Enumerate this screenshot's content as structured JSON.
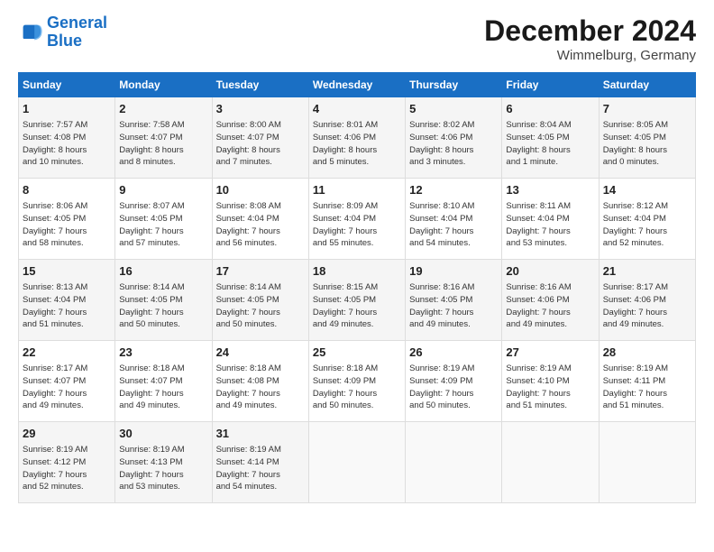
{
  "logo": {
    "line1": "General",
    "line2": "Blue"
  },
  "title": "December 2024",
  "location": "Wimmelburg, Germany",
  "days_of_week": [
    "Sunday",
    "Monday",
    "Tuesday",
    "Wednesday",
    "Thursday",
    "Friday",
    "Saturday"
  ],
  "weeks": [
    [
      {
        "day": "1",
        "sunrise": "7:57 AM",
        "sunset": "4:08 PM",
        "daylight": "8 hours and 10 minutes."
      },
      {
        "day": "2",
        "sunrise": "7:58 AM",
        "sunset": "4:07 PM",
        "daylight": "8 hours and 8 minutes."
      },
      {
        "day": "3",
        "sunrise": "8:00 AM",
        "sunset": "4:07 PM",
        "daylight": "8 hours and 7 minutes."
      },
      {
        "day": "4",
        "sunrise": "8:01 AM",
        "sunset": "4:06 PM",
        "daylight": "8 hours and 5 minutes."
      },
      {
        "day": "5",
        "sunrise": "8:02 AM",
        "sunset": "4:06 PM",
        "daylight": "8 hours and 3 minutes."
      },
      {
        "day": "6",
        "sunrise": "8:04 AM",
        "sunset": "4:05 PM",
        "daylight": "8 hours and 1 minute."
      },
      {
        "day": "7",
        "sunrise": "8:05 AM",
        "sunset": "4:05 PM",
        "daylight": "8 hours and 0 minutes."
      }
    ],
    [
      {
        "day": "8",
        "sunrise": "8:06 AM",
        "sunset": "4:05 PM",
        "daylight": "7 hours and 58 minutes."
      },
      {
        "day": "9",
        "sunrise": "8:07 AM",
        "sunset": "4:05 PM",
        "daylight": "7 hours and 57 minutes."
      },
      {
        "day": "10",
        "sunrise": "8:08 AM",
        "sunset": "4:04 PM",
        "daylight": "7 hours and 56 minutes."
      },
      {
        "day": "11",
        "sunrise": "8:09 AM",
        "sunset": "4:04 PM",
        "daylight": "7 hours and 55 minutes."
      },
      {
        "day": "12",
        "sunrise": "8:10 AM",
        "sunset": "4:04 PM",
        "daylight": "7 hours and 54 minutes."
      },
      {
        "day": "13",
        "sunrise": "8:11 AM",
        "sunset": "4:04 PM",
        "daylight": "7 hours and 53 minutes."
      },
      {
        "day": "14",
        "sunrise": "8:12 AM",
        "sunset": "4:04 PM",
        "daylight": "7 hours and 52 minutes."
      }
    ],
    [
      {
        "day": "15",
        "sunrise": "8:13 AM",
        "sunset": "4:04 PM",
        "daylight": "7 hours and 51 minutes."
      },
      {
        "day": "16",
        "sunrise": "8:14 AM",
        "sunset": "4:05 PM",
        "daylight": "7 hours and 50 minutes."
      },
      {
        "day": "17",
        "sunrise": "8:14 AM",
        "sunset": "4:05 PM",
        "daylight": "7 hours and 50 minutes."
      },
      {
        "day": "18",
        "sunrise": "8:15 AM",
        "sunset": "4:05 PM",
        "daylight": "7 hours and 49 minutes."
      },
      {
        "day": "19",
        "sunrise": "8:16 AM",
        "sunset": "4:05 PM",
        "daylight": "7 hours and 49 minutes."
      },
      {
        "day": "20",
        "sunrise": "8:16 AM",
        "sunset": "4:06 PM",
        "daylight": "7 hours and 49 minutes."
      },
      {
        "day": "21",
        "sunrise": "8:17 AM",
        "sunset": "4:06 PM",
        "daylight": "7 hours and 49 minutes."
      }
    ],
    [
      {
        "day": "22",
        "sunrise": "8:17 AM",
        "sunset": "4:07 PM",
        "daylight": "7 hours and 49 minutes."
      },
      {
        "day": "23",
        "sunrise": "8:18 AM",
        "sunset": "4:07 PM",
        "daylight": "7 hours and 49 minutes."
      },
      {
        "day": "24",
        "sunrise": "8:18 AM",
        "sunset": "4:08 PM",
        "daylight": "7 hours and 49 minutes."
      },
      {
        "day": "25",
        "sunrise": "8:18 AM",
        "sunset": "4:09 PM",
        "daylight": "7 hours and 50 minutes."
      },
      {
        "day": "26",
        "sunrise": "8:19 AM",
        "sunset": "4:09 PM",
        "daylight": "7 hours and 50 minutes."
      },
      {
        "day": "27",
        "sunrise": "8:19 AM",
        "sunset": "4:10 PM",
        "daylight": "7 hours and 51 minutes."
      },
      {
        "day": "28",
        "sunrise": "8:19 AM",
        "sunset": "4:11 PM",
        "daylight": "7 hours and 51 minutes."
      }
    ],
    [
      {
        "day": "29",
        "sunrise": "8:19 AM",
        "sunset": "4:12 PM",
        "daylight": "7 hours and 52 minutes."
      },
      {
        "day": "30",
        "sunrise": "8:19 AM",
        "sunset": "4:13 PM",
        "daylight": "7 hours and 53 minutes."
      },
      {
        "day": "31",
        "sunrise": "8:19 AM",
        "sunset": "4:14 PM",
        "daylight": "7 hours and 54 minutes."
      },
      null,
      null,
      null,
      null
    ]
  ]
}
